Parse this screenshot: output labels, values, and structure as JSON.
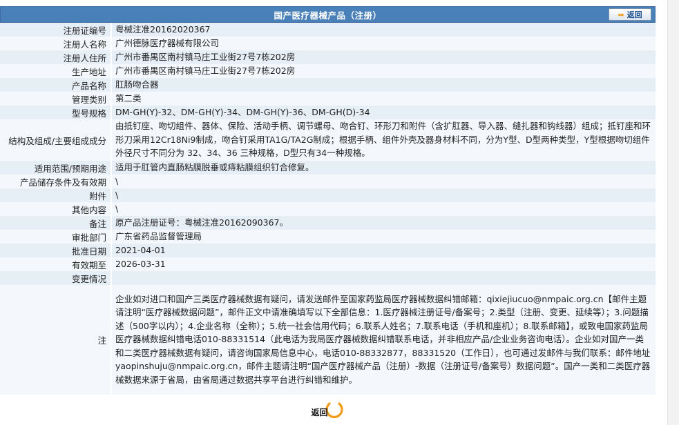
{
  "header": {
    "title": "国产医疗器械产品（注册）",
    "back_label": "返回"
  },
  "rows": [
    {
      "label": "注册证编号",
      "value": "粤械注准20162020367"
    },
    {
      "label": "注册人名称",
      "value": "广州德脉医疗器械有限公司"
    },
    {
      "label": "注册人住所",
      "value": "广州市番禺区南村镇马庄工业街27号7栋202房"
    },
    {
      "label": "生产地址",
      "value": "广州市番禺区南村镇马庄工业街27号7栋202房"
    },
    {
      "label": "产品名称",
      "value": "肛肠吻合器"
    },
    {
      "label": "管理类别",
      "value": "第二类"
    },
    {
      "label": "型号规格",
      "value": "DM-GH(Y)-32、DM-GH(Y)-34、DM-GH(Y)-36、DM-GH(D)-34"
    },
    {
      "label": "结构及组成/主要组成成分",
      "value": "由抵钉座、吻切组件、器体、保险、活动手柄、调节螺母、吻合钉、环形刀和附件（含扩肛器、导入器、缝扎器和钩线器）组成；抵钉座和环形刀采用12Cr18Ni9制成，吻合钉采用TA1G/TA2G制成；根据手柄、组件外壳及器身材料不同，分为Y型、D型两种类型，Y型根据吻切组件外径尺寸不同分为 32、34、36 三种规格，D型只有34一种规格。"
    },
    {
      "label": "适用范围/预期用途",
      "value": "适用于肛管内直肠粘膜脱垂或痔粘膜组织钉合修复。"
    },
    {
      "label": "产品储存条件及有效期",
      "value": "\\"
    },
    {
      "label": "附件",
      "value": "\\"
    },
    {
      "label": "其他内容",
      "value": "\\"
    },
    {
      "label": "备注",
      "value": "原产品注册证号：粤械注准20162090367。"
    },
    {
      "label": "审批部门",
      "value": "广东省药品监督管理局"
    },
    {
      "label": "批准日期",
      "value": "2021-04-01"
    },
    {
      "label": "有效期至",
      "value": "2026-03-31"
    },
    {
      "label": "变更情况",
      "value": ""
    },
    {
      "label": "注",
      "value": "企业如对进口和国产三类医疗器械数据有疑问，请发送邮件至国家药监局医疗器械数据纠错邮箱：qixiejiucuo@nmpaic.org.cn【邮件主题请注明“医疗器械数据问题”，邮件正文中请准确填写以下全部信息：1.医疗器械注册证号/备案号；2.类型（注册、变更、延续等）；3.问题描述（500字以内）；4.企业名称（全称）；5.统一社会信用代码；6.联系人姓名；7.联系电话（手机和座机）；8.联系邮箱】，或致电国家药监局医疗器械数据纠错电话010-88331514（此电话为我局医疗器械数据纠错联系电话，并非相应产品/企业业务咨询电话）。企业如对国产一类和二类医疗器械数据有疑问，请咨询国家局信息中心，电话010-88332877，88331520（工作日），也可通过发邮件与我们联系：邮件地址yaopinshuju@nmpaic.org.cn，邮件主题请注明“国产医疗器械产品（注册）-数据（注册证号/备案号）数据问题”。国产一类和二类医疗器械数据来源于省局，由省局通过数据共享平台进行纠错和维护。"
    }
  ],
  "footer": {
    "back_label": "返回"
  },
  "colors": {
    "title_bg": "#4a80b8",
    "row_a": "#e6eef6",
    "row_b": "#f4f7fb",
    "accent": "#f29a1a"
  }
}
